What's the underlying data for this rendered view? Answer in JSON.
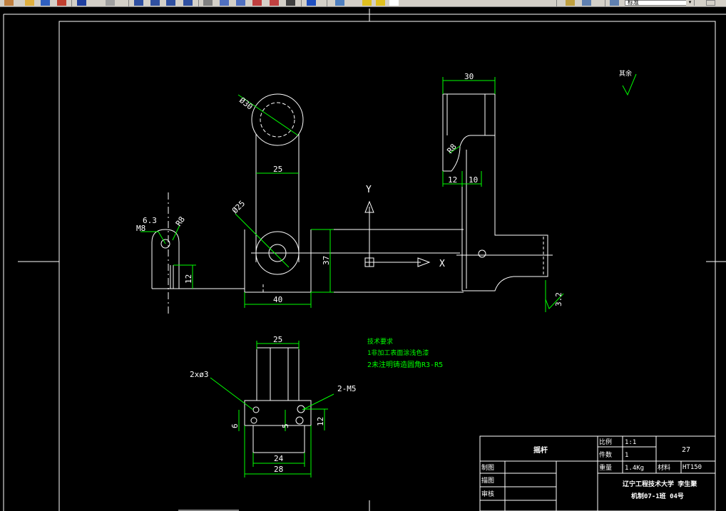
{
  "toolbar": {
    "style_value": "标准"
  },
  "dimensions": {
    "d30_top": "30",
    "phi30": "Ø30",
    "d25_arm": "25",
    "phi25": "Ø25",
    "d40": "40",
    "d37": "37",
    "d12_left": "12",
    "d6_3": "6.3",
    "m8": "M8",
    "r8": "R8",
    "d12_right": "12",
    "d10_right": "10",
    "r8_right": "R8",
    "d25_bottom": "25",
    "hole_2x3": "2xø3",
    "m5_2": "2-M5",
    "d6": "6",
    "d5": "5",
    "d12_bottom": "12",
    "d24": "24",
    "d28": "28",
    "rough_3_2": "3.2",
    "rest": "其余"
  },
  "axes": {
    "y_label": "Y",
    "x_label": "X"
  },
  "tech_notes": {
    "title": "技术要求",
    "line1": "1非加工表面涂浅色漆",
    "line2": "2未注明铸造圆角R3-R5"
  },
  "title_block": {
    "part_name": "摇杆",
    "scale_label": "比例",
    "scale_value": "1:1",
    "count_label": "件数",
    "count_value": "1",
    "sheet_no": "27",
    "weight_label": "重量",
    "weight_value": "1.4Kg",
    "material_label": "材料",
    "material_value": "HT150",
    "drawn_label": "制图",
    "drafter_label": "描图",
    "review_label": "审核",
    "school": "辽宁工程技术大学 李生聚",
    "class": "机制07-1班 04号"
  }
}
